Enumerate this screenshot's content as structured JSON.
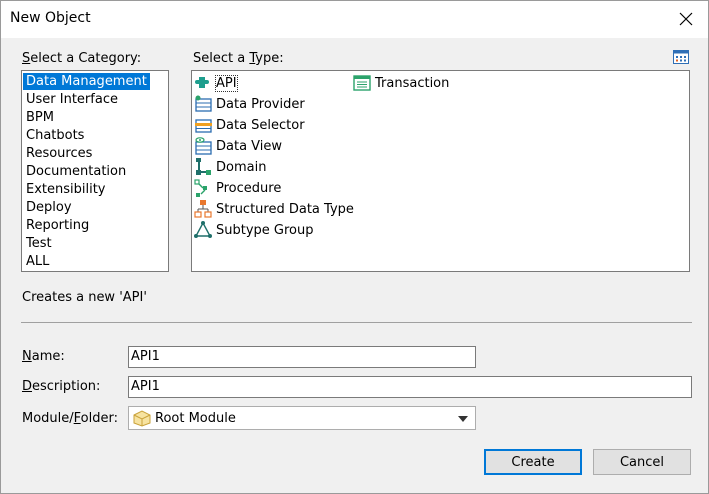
{
  "window": {
    "title": "New Object"
  },
  "category": {
    "label_pre": "",
    "label_u": "S",
    "label_post": "elect a Category:",
    "items": [
      "Data Management",
      "User Interface",
      "BPM",
      "Chatbots",
      "Resources",
      "Documentation",
      "Extensibility",
      "Deploy",
      "Reporting",
      "Test",
      "ALL"
    ],
    "selected": "Data Management"
  },
  "type": {
    "label_pre": "Select a ",
    "label_u": "T",
    "label_post": "ype:",
    "items": [
      {
        "label": "API",
        "icon": "api-icon"
      },
      {
        "label": "Data Provider",
        "icon": "data-provider-icon"
      },
      {
        "label": "Data Selector",
        "icon": "data-selector-icon"
      },
      {
        "label": "Data View",
        "icon": "data-view-icon"
      },
      {
        "label": "Domain",
        "icon": "domain-icon"
      },
      {
        "label": "Procedure",
        "icon": "procedure-icon"
      },
      {
        "label": "Structured Data Type",
        "icon": "structured-data-type-icon"
      },
      {
        "label": "Subtype Group",
        "icon": "subtype-group-icon"
      },
      {
        "label": "Transaction",
        "icon": "transaction-icon"
      }
    ],
    "selected": "API"
  },
  "description_text": "Creates a new 'API'",
  "form": {
    "name_label_u": "N",
    "name_label_post": "ame:",
    "name_value": "API1",
    "desc_label_u": "D",
    "desc_label_post": "escription:",
    "desc_value": "API1",
    "module_label_pre": "Module/",
    "module_label_u": "F",
    "module_label_post": "older:",
    "module_value": "Root Module"
  },
  "buttons": {
    "create": "Create",
    "cancel": "Cancel"
  },
  "colors": {
    "selection": "#0078d7",
    "accent_green": "#1e9e6e"
  }
}
